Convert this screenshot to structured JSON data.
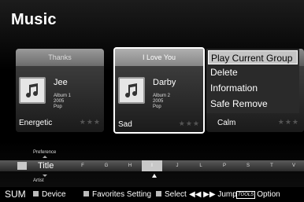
{
  "app": {
    "title": "Music"
  },
  "cards": [
    {
      "song": "Thanks",
      "artist": "Jee",
      "album": "Album 1",
      "year": "2005",
      "genre": "Pop",
      "mood": "Energetic",
      "stars": "★★★"
    },
    {
      "song": "I Love You",
      "artist": "Darby",
      "album": "Album 2",
      "year": "2005",
      "genre": "Pop",
      "mood": "Sad",
      "stars": "★★★"
    },
    {
      "mood": "Calm",
      "stars": "★★★"
    }
  ],
  "context_menu": {
    "items": [
      "Play Current Group",
      "Delete",
      "Information",
      "Safe Remove"
    ],
    "active_index": 0
  },
  "sort": {
    "above_label": "Preference",
    "current_label": "Title",
    "below_label": "Artist",
    "letters": [
      "F",
      "G",
      "H",
      "I",
      "J",
      "L",
      "P",
      "S",
      "T",
      "V"
    ],
    "current_letter": "I"
  },
  "legend": {
    "sum": "SUM",
    "device": "Device",
    "favorites": "Favorites Setting",
    "select": "Select",
    "jump": "◀◀ ▶▶ Jump",
    "tools_badge": "TOOLS",
    "option": "Option"
  },
  "colors": {
    "menu_highlight": "#c4c4c4",
    "card_header": "#8c8c8c",
    "background": "#000000"
  }
}
